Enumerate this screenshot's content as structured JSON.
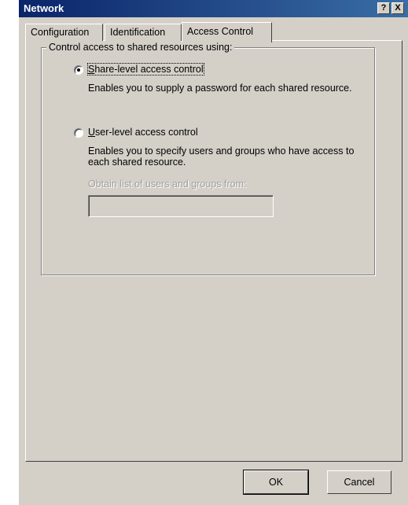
{
  "window": {
    "title": "Network",
    "help_btn": "?",
    "close_btn": "X"
  },
  "tabs": [
    {
      "label": "Configuration",
      "active": false
    },
    {
      "label": "Identification",
      "active": false
    },
    {
      "label": "Access Control",
      "active": true
    }
  ],
  "group": {
    "legend": "Control access to shared resources using:"
  },
  "options": [
    {
      "label_first": "S",
      "label_rest": "hare-level access control",
      "selected": true,
      "description": "Enables you to supply a password for each shared resource."
    },
    {
      "label_first": "U",
      "label_rest": "ser-level access control",
      "selected": false,
      "description": "Enables you to specify users and groups who have access to each shared resource."
    }
  ],
  "obtain_list": {
    "label": "Obtain list of users and groups from:",
    "value": ""
  },
  "buttons": {
    "ok": "OK",
    "cancel": "Cancel"
  }
}
